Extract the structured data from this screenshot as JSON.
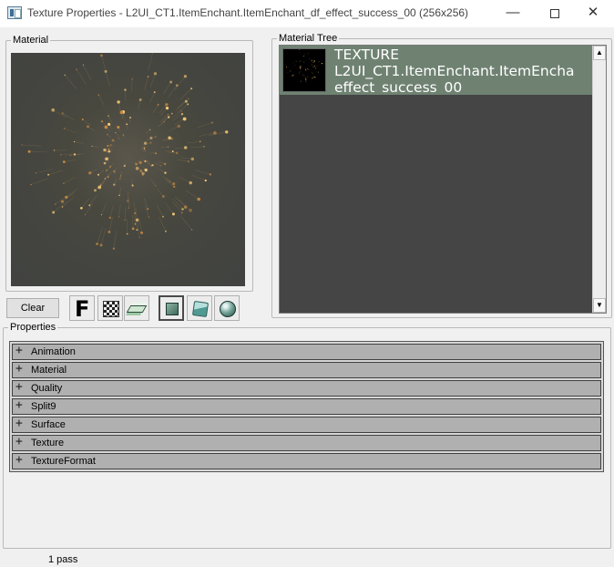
{
  "window": {
    "title": "Texture Properties - L2UI_CT1.ItemEnchant.ItemEnchant_df_effect_success_00 (256x256)",
    "minimize_glyph": "—",
    "close_glyph": "✕"
  },
  "material": {
    "label": "Material"
  },
  "material_tree": {
    "label": "Material Tree",
    "item": {
      "line1": "TEXTURE",
      "line2": "L2UI_CT1.ItemEnchant.ItemEncha",
      "line3": "effect_success_00"
    },
    "scroll_up_glyph": "▲",
    "scroll_down_glyph": "▼"
  },
  "toolbar": {
    "clear_label": "Clear",
    "f_label": "F",
    "icons": [
      "fallback-icon",
      "checker-background-icon",
      "layers-icon",
      "plane-preview-icon",
      "cube-preview-icon",
      "sphere-preview-icon"
    ]
  },
  "properties": {
    "label": "Properties",
    "expand_glyph": "+",
    "items": [
      {
        "label": "Animation"
      },
      {
        "label": "Material"
      },
      {
        "label": "Quality"
      },
      {
        "label": "Split9"
      },
      {
        "label": "Surface"
      },
      {
        "label": "Texture"
      },
      {
        "label": "TextureFormat"
      }
    ]
  },
  "status": {
    "text": "1 pass"
  }
}
